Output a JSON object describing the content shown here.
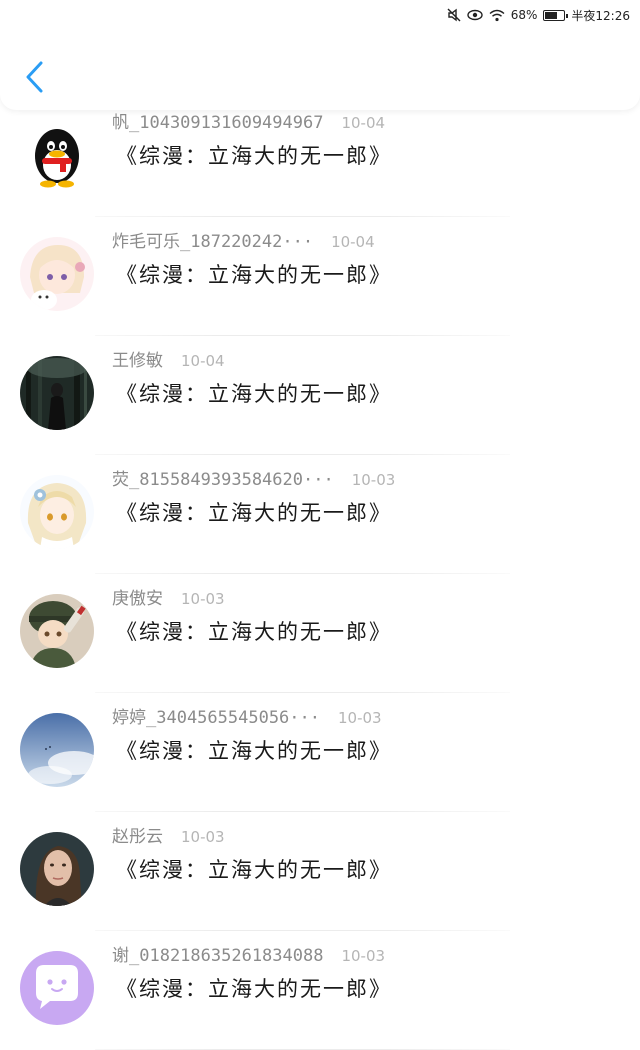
{
  "status_bar": {
    "battery": "68%",
    "time": "半夜12:26",
    "battery_level": 0.68,
    "icons": [
      "mute-icon",
      "eye-icon",
      "wifi-icon",
      "battery-icon"
    ]
  },
  "header": {
    "back_icon": "chevron-left-icon",
    "accent_color": "#2a9df4"
  },
  "items": [
    {
      "user": "帆_104309131609494967",
      "date": "10-04",
      "title": "《综漫：立海大的无一郎》",
      "avatar": "penguin-avatar",
      "avatar_colors": [
        "#ffffff",
        "#111111"
      ]
    },
    {
      "user": "炸毛可乐_187220242···",
      "date": "10-04",
      "title": "《综漫：立海大的无一郎》",
      "avatar": "anime-girl-avatar",
      "avatar_colors": [
        "#f6e3c8",
        "#e9a8b8"
      ]
    },
    {
      "user": "王修敏",
      "date": "10-04",
      "title": "《综漫：立海大的无一郎》",
      "avatar": "forest-avatar",
      "avatar_colors": [
        "#1f2a26",
        "#4c5e55"
      ]
    },
    {
      "user": "荧_8155849393584620···",
      "date": "10-03",
      "title": "《综漫：立海大的无一郎》",
      "avatar": "anime-blonde-avatar",
      "avatar_colors": [
        "#f3e6c6",
        "#9fc2dc"
      ]
    },
    {
      "user": "庚傲安",
      "date": "10-03",
      "title": "《综漫：立海大的无一郎》",
      "avatar": "soldier-avatar",
      "avatar_colors": [
        "#3e4a33",
        "#d9cdbd"
      ]
    },
    {
      "user": "婷婷_3404565545056···",
      "date": "10-03",
      "title": "《综漫：立海大的无一郎》",
      "avatar": "sky-avatar",
      "avatar_colors": [
        "#4a6fa8",
        "#c9d9ea"
      ]
    },
    {
      "user": "赵彤云",
      "date": "10-03",
      "title": "《综漫：立海大的无一郎》",
      "avatar": "portrait-avatar",
      "avatar_colors": [
        "#2d3a3e",
        "#e2bfa9"
      ]
    },
    {
      "user": "谢_018218635261834088",
      "date": "10-03",
      "title": "《综漫：立海大的无一郎》",
      "avatar": "chat-bubble-avatar",
      "avatar_colors": [
        "#c8a8f2",
        "#ffffff"
      ]
    }
  ]
}
